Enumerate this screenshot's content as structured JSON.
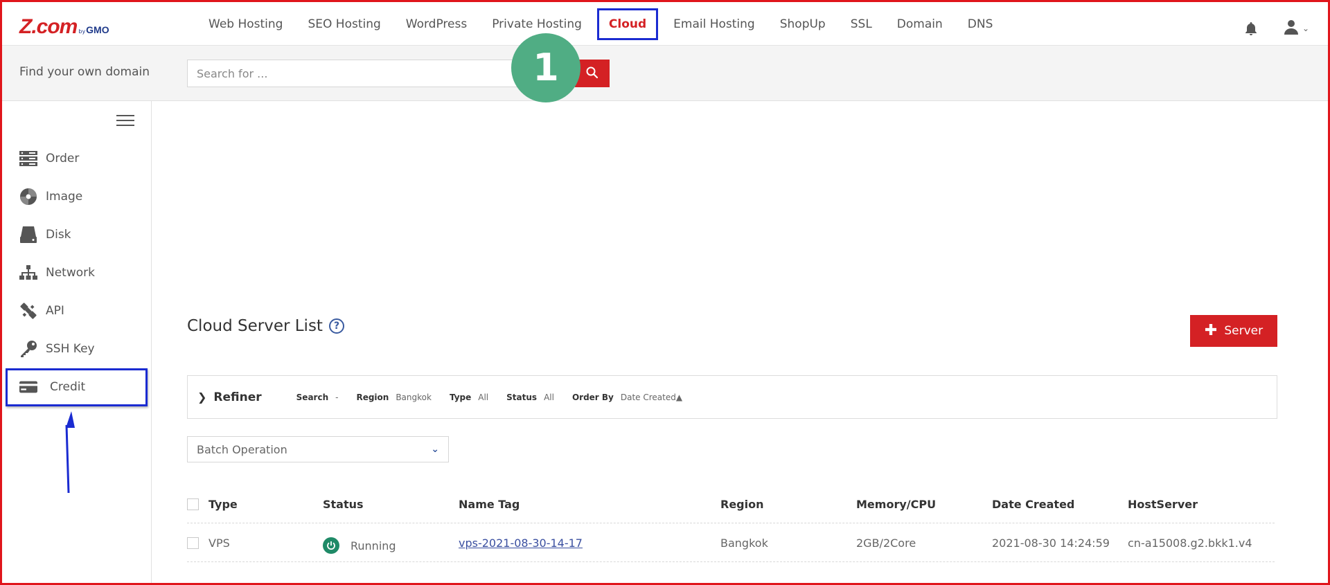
{
  "brand": {
    "main": "Z.com",
    "by": "by",
    "sub": "GMO"
  },
  "nav": {
    "items": [
      {
        "label": "Web Hosting"
      },
      {
        "label": "SEO Hosting"
      },
      {
        "label": "WordPress"
      },
      {
        "label": "Private Hosting"
      },
      {
        "label": "Cloud",
        "active": true
      },
      {
        "label": "Email Hosting"
      },
      {
        "label": "ShopUp"
      },
      {
        "label": "SSL"
      },
      {
        "label": "Domain"
      },
      {
        "label": "DNS"
      }
    ],
    "icons": [
      "bell-icon",
      "user-icon",
      "chevron-down-icon"
    ]
  },
  "search": {
    "label": "Find your own domain",
    "placeholder": "Search for ..."
  },
  "annotation": {
    "step": "1"
  },
  "sidebar": {
    "items": [
      {
        "label": "Order",
        "icon": "server-icon"
      },
      {
        "label": "Image",
        "icon": "disc-icon"
      },
      {
        "label": "Disk",
        "icon": "disk-icon"
      },
      {
        "label": "Network",
        "icon": "network-icon"
      },
      {
        "label": "API",
        "icon": "api-icon"
      },
      {
        "label": "SSH Key",
        "icon": "key-icon"
      },
      {
        "label": "Credit",
        "icon": "credit-card-icon",
        "highlighted": true
      }
    ]
  },
  "main": {
    "title": "Cloud Server List",
    "add_button": "Server",
    "refiner": {
      "title": "Refiner",
      "filters": [
        {
          "key": "Search",
          "value": "-"
        },
        {
          "key": "Region",
          "value": "Bangkok"
        },
        {
          "key": "Type",
          "value": "All"
        },
        {
          "key": "Status",
          "value": "All"
        },
        {
          "key": "Order By",
          "value": "Date Created▲"
        }
      ]
    },
    "batch": {
      "label": "Batch Operation"
    },
    "table": {
      "headers": [
        "Type",
        "Status",
        "Name Tag",
        "Region",
        "Memory/CPU",
        "Date Created",
        "HostServer"
      ],
      "rows": [
        {
          "type": "VPS",
          "status": "Running",
          "name_tag": "vps-2021-08-30-14-17",
          "region": "Bangkok",
          "memory_cpu": "2GB/2Core",
          "date_created": "2021-08-30 14:24:59",
          "host_server": "cn-a15008.g2.bkk1.v4"
        }
      ]
    }
  },
  "colors": {
    "brand_red": "#d42124",
    "highlight_blue": "#1a2bd1",
    "badge_green": "#50ad84",
    "running_green": "#1f8a67"
  }
}
